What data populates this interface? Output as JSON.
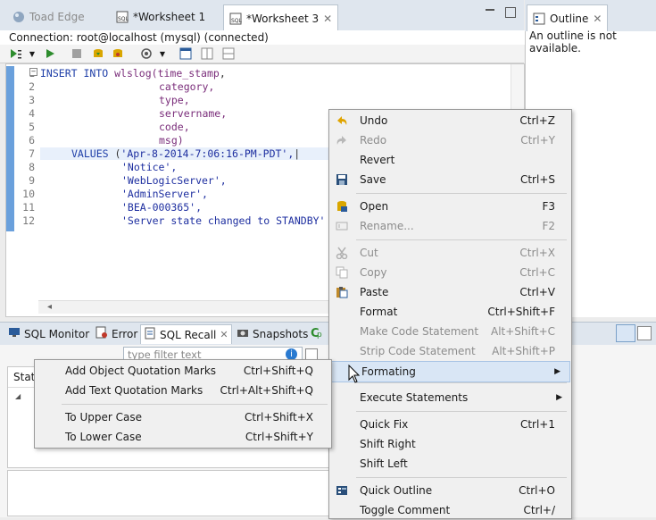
{
  "editor_tabs": {
    "toad_edge": "Toad Edge",
    "worksheet1": "*Worksheet 1",
    "worksheet3": "*Worksheet 3"
  },
  "connection": "Connection: root@localhost (mysql) (connected)",
  "code_lines": {
    "n1": "1",
    "n2": "2",
    "n3": "3",
    "n4": "4",
    "n5": "5",
    "n6": "6",
    "n7": "7",
    "n8": "8",
    "n9": "9",
    "n10": "10",
    "n11": "11",
    "n12": "12",
    "l1_kw": "INSERT INTO",
    "l1_fn": "wlslog(",
    "l1_col": "time_stamp",
    "l2": "category,",
    "l3": "type,",
    "l4": "servername,",
    "l5": "code,",
    "l6": "msg)",
    "l7_kw": "VALUES",
    "l7_str": "'Apr-8-2014-7:06:16-PM-PDT',",
    "l8": "'Notice',",
    "l9": "'WebLogicServer',",
    "l10": "'AdminServer',",
    "l11": "'BEA-000365',",
    "l12": "'Server state changed to STANDBY'"
  },
  "outline": {
    "tab": "Outline",
    "message": "An outline is not available."
  },
  "bottom_tabs": {
    "sql_monitor": "SQL Monitor",
    "error": "Error",
    "sql_recall": "SQL Recall",
    "snapshots": "Snapshots"
  },
  "filter_placeholder": "type filter text",
  "grid_header": "State",
  "context_menu": {
    "undo": "Undo",
    "undo_sc": "Ctrl+Z",
    "redo": "Redo",
    "redo_sc": "Ctrl+Y",
    "revert": "Revert",
    "save": "Save",
    "save_sc": "Ctrl+S",
    "open": "Open",
    "open_sc": "F3",
    "rename": "Rename...",
    "rename_sc": "F2",
    "cut": "Cut",
    "cut_sc": "Ctrl+X",
    "copy": "Copy",
    "copy_sc": "Ctrl+C",
    "paste": "Paste",
    "paste_sc": "Ctrl+V",
    "format": "Format",
    "format_sc": "Ctrl+Shift+F",
    "make_code": "Make Code Statement",
    "make_code_sc": "Alt+Shift+C",
    "strip_code": "Strip Code Statement",
    "strip_code_sc": "Alt+Shift+P",
    "formating": "Formating",
    "execute": "Execute Statements",
    "quick_fix": "Quick Fix",
    "quick_fix_sc": "Ctrl+1",
    "shift_right": "Shift Right",
    "shift_left": "Shift Left",
    "quick_outline": "Quick Outline",
    "quick_outline_sc": "Ctrl+O",
    "toggle_comment": "Toggle Comment",
    "toggle_comment_sc": "Ctrl+/"
  },
  "submenu": {
    "add_object": "Add Object Quotation Marks",
    "add_object_sc": "Ctrl+Shift+Q",
    "add_text": "Add Text Quotation Marks",
    "add_text_sc": "Ctrl+Alt+Shift+Q",
    "upper": "To Upper Case",
    "upper_sc": "Ctrl+Shift+X",
    "lower": "To Lower Case",
    "lower_sc": "Ctrl+Shift+Y"
  },
  "colors": {
    "accent": "#6aa0dc",
    "keyword": "#1f3fa8",
    "identifier": "#7a2d7a",
    "string": "#1e2fa0"
  }
}
